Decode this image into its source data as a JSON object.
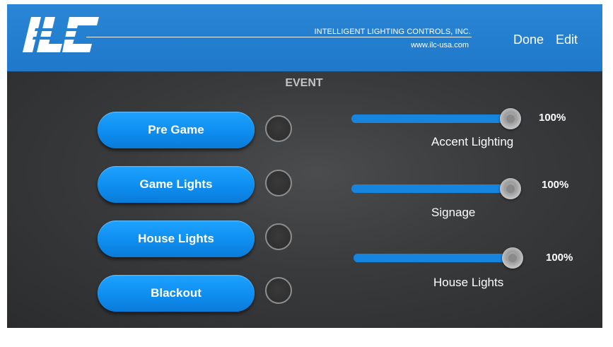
{
  "header": {
    "company_name": "INTELLIGENT LIGHTING CONTROLS, INC.",
    "company_url": "www.ilc-usa.com",
    "done_label": "Done",
    "edit_label": "Edit",
    "logo_icon": "ilc-logo",
    "background_color": "#2281d1"
  },
  "event": {
    "title": "EVENT",
    "buttons": [
      {
        "label": "Pre Game"
      },
      {
        "label": "Game Lights"
      },
      {
        "label": "House Lights"
      },
      {
        "label": "Blackout"
      }
    ],
    "button_color": "#1499f7"
  },
  "channels": [
    {
      "label": "Accent Lighting",
      "level_text": "100%",
      "level": 1.0
    },
    {
      "label": "Signage",
      "level_text": "100%",
      "level": 1.0
    },
    {
      "label": "House Lights",
      "level_text": "100%",
      "level": 1.0
    }
  ]
}
